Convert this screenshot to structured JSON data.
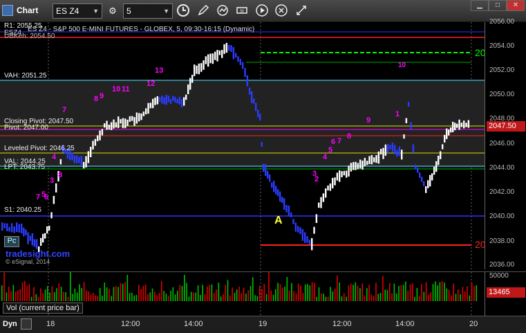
{
  "window": {
    "title": "Chart"
  },
  "toolbar": {
    "symbol": "ES Z4",
    "interval": "5",
    "icons": [
      "clock-icon",
      "pencil-icon",
      "refresh-icon",
      "study-icon",
      "play-icon",
      "close-circle-icon",
      "move-icon"
    ]
  },
  "chart": {
    "instrument_line": "ES Z4 - S&P 500 E-MINI FUTURES - GLOBEX, 5, 09:30-16:15 (Dynamic)",
    "instrument_prefix": "ESZ4",
    "r1_label": "R1: 2055.25",
    "obscured_label": "UBKeh: 2054.50",
    "vah_label": "VAH: 2051.25",
    "closing_pivot_label": "Closing Pivot: 2047.50",
    "pivot_label": "Pivot: 2047.00",
    "leveled_pivot_label": "Leveled Pivot: 2046.25",
    "val_label": "VAL: 2044.25",
    "lpt_label": "LPT: 2043.75",
    "s1_label": "S1: 2040.25",
    "watermark_site": "tradesight.com",
    "copyright": "© eSignal, 2014",
    "pc_button": "Pc",
    "marker_a": "A",
    "count_20_top": "20",
    "count_20_bottom": "20",
    "count_10": "10",
    "seq_labels": [
      "7",
      "8",
      "9",
      "10",
      "11",
      "12",
      "13",
      "3",
      "4",
      "5",
      "6",
      "7",
      "8",
      "9",
      "1",
      "2",
      "3",
      "4",
      "5",
      "6",
      "7",
      "8"
    ]
  },
  "price_axis": {
    "ticks": [
      "2056.00",
      "2054.00",
      "2052.00",
      "2050.00",
      "2048.00",
      "2046.00",
      "2044.00",
      "2042.00",
      "2040.00",
      "2038.00",
      "2036.00"
    ],
    "current_price": "2047.50"
  },
  "volume": {
    "label": "Vol (current price bar)",
    "axis_top": "50000",
    "current": "13465"
  },
  "time_axis": {
    "left_label": "Dyn",
    "labels": [
      "18",
      "12:00",
      "14:00",
      "19",
      "12:00",
      "14:00",
      "20"
    ]
  },
  "colors": {
    "up_bar": "#ffffff",
    "down_bar": "#2a3cff",
    "r1": "#ff2020",
    "vah": "#40e0ff",
    "pivot_yellow": "#e0e000",
    "s1": "#3030ff",
    "green_target": "#00ff00",
    "red_target": "#ff2020",
    "magenta": "#ff00ff",
    "vol_green": "#00c000",
    "vol_red": "#e00000"
  }
}
